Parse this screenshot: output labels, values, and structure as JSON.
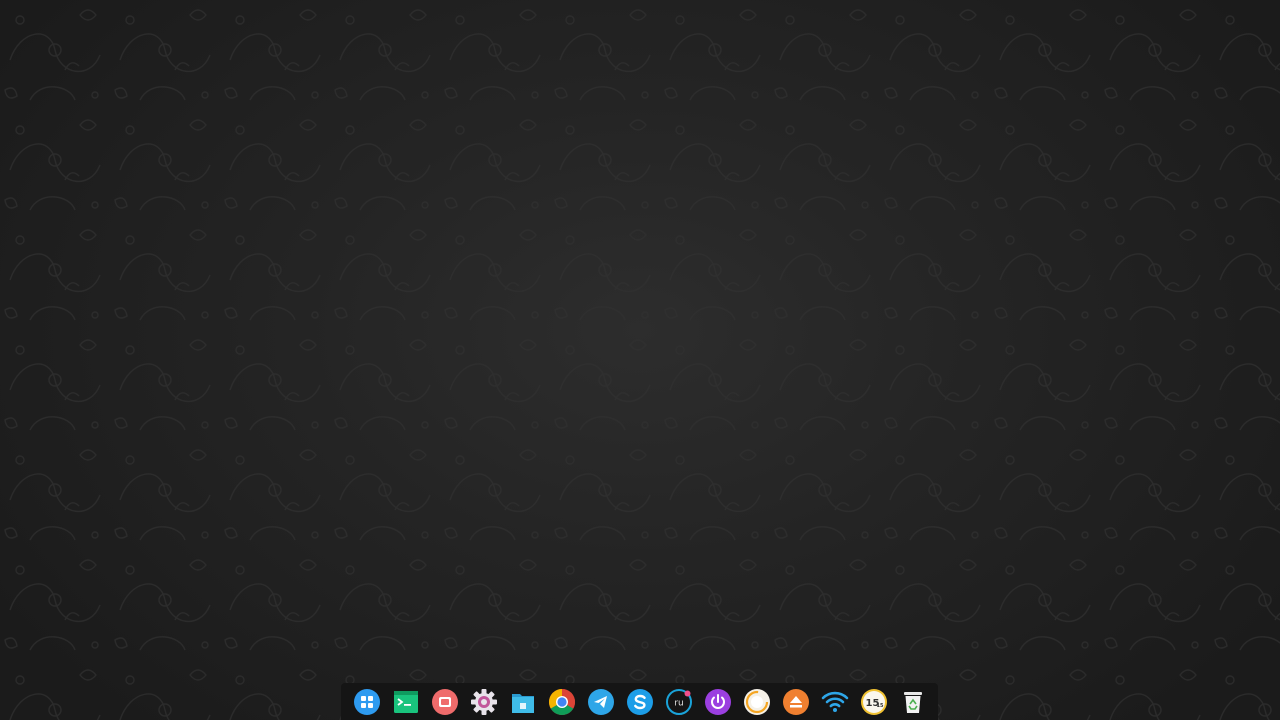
{
  "desktop": {
    "background_color": "#242424",
    "pattern_color": "#2c2c2c"
  },
  "dock": {
    "background_color": "#151515",
    "items": [
      {
        "name": "launcher",
        "icon": "launcher-icon",
        "color": "#2e9bf0"
      },
      {
        "name": "terminal",
        "icon": "terminal-icon",
        "color": "#19c37d"
      },
      {
        "name": "screen-recorder",
        "icon": "screen-recorder-icon",
        "color": "#ef6b6b"
      },
      {
        "name": "settings",
        "icon": "gear-icon",
        "color": "#e8e3ea"
      },
      {
        "name": "file-manager",
        "icon": "folder-icon",
        "color": "#3fbce8"
      },
      {
        "name": "chrome",
        "icon": "chrome-icon",
        "color": "#db4437"
      },
      {
        "name": "telegram",
        "icon": "telegram-icon",
        "color": "#2ea6e8"
      },
      {
        "name": "skype",
        "icon": "skype-icon",
        "color": "#1d9ee8"
      },
      {
        "name": "keyboard-layout",
        "icon": "keyboard-layout-icon",
        "color": "#1aa3d9"
      },
      {
        "name": "power",
        "icon": "power-icon",
        "color": "#9b3fe0"
      },
      {
        "name": "sound",
        "icon": "sound-icon",
        "color": "#f5a623"
      },
      {
        "name": "eject",
        "icon": "eject-icon",
        "color": "#f08030"
      },
      {
        "name": "wifi",
        "icon": "wifi-icon",
        "color": "#2ea6e8"
      },
      {
        "name": "clock",
        "icon": "clock-icon",
        "color": "#f1c232"
      },
      {
        "name": "trash",
        "icon": "trash-icon",
        "color": "#f2f2f2"
      }
    ],
    "keyboard_layout": "ru",
    "clock": {
      "hours": "15",
      "minutes": "15"
    }
  }
}
